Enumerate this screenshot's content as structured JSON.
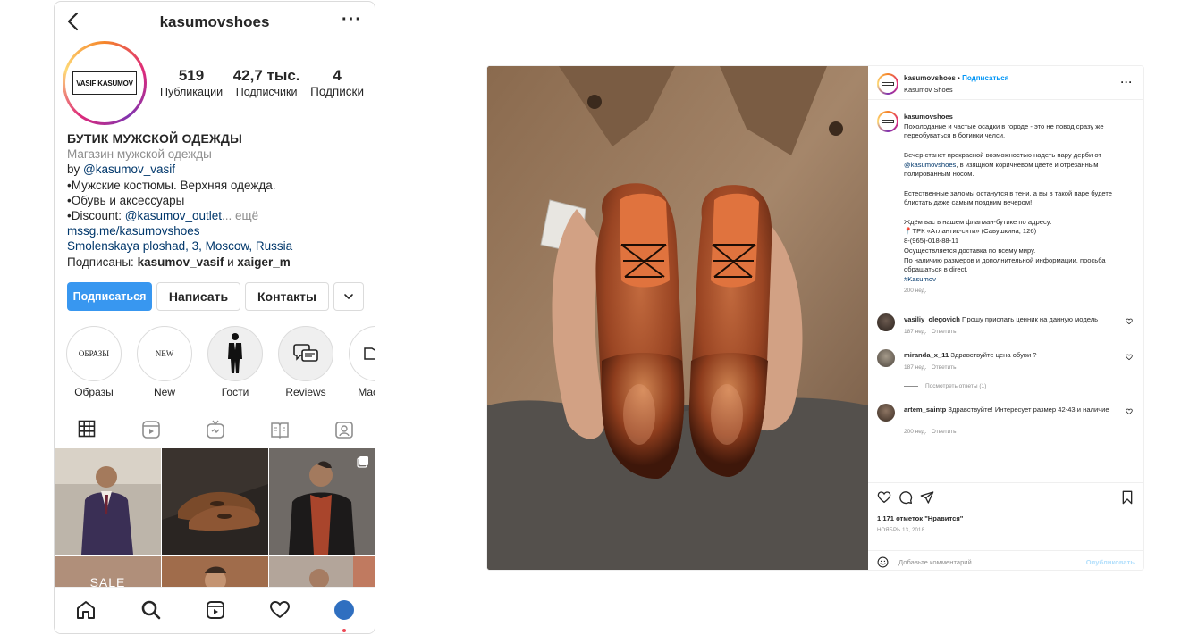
{
  "profile": {
    "username": "kasumovshoes",
    "logo_text": "VASIF KASUMOV",
    "stats": [
      {
        "value": "519",
        "label": "Публикации"
      },
      {
        "value": "42,7 тыс.",
        "label": "Подписчики"
      },
      {
        "value": "4",
        "label": "Подписки"
      }
    ],
    "bio": {
      "name": "БУТИК МУЖСКОЙ ОДЕЖДЫ",
      "category": "Магазин мужской одежды",
      "by_prefix": "by ",
      "by_handle": "@kasumov_vasif",
      "line1": "•Мужские костюмы. Верхняя одежда.",
      "line2": "•Обувь и аксессуары",
      "line3_prefix": "•Discount: ",
      "line3_handle": "@kasumov_outlet",
      "more": "... ещё",
      "link": "mssg.me/kasumovshoes",
      "address": "Smolenskaya ploshad, 3, Moscow, Russia",
      "followed_prefix": "Подписаны: ",
      "followed_user1": "kasumov_vasif",
      "followed_and": " и ",
      "followed_user2": "xaiger_m"
    },
    "buttons": {
      "follow": "Подписаться",
      "message": "Написать",
      "contacts": "Контакты"
    },
    "highlights": [
      {
        "label": "Образы",
        "cover": "ОБРАЗЫ"
      },
      {
        "label": "New",
        "cover": "NEW"
      },
      {
        "label": "Гости",
        "cover": ""
      },
      {
        "label": "Reviews",
        "cover": ""
      },
      {
        "label": "Мастер",
        "cover": ""
      }
    ],
    "grid_sale_text": "SALE"
  },
  "post": {
    "username": "kasumovshoes",
    "follow": "Подписаться",
    "separator": "•",
    "location": "Kasumov Shoes",
    "caption": {
      "user": "kasumovshoes",
      "p1": "Похолодание и частые осадки в городе - это не повод сразу же переобуваться в ботинки челси.",
      "p2_before": "Вечер станет прекрасной возможностью надеть пару дерби от ",
      "p2_link": "@kasumovshoes",
      "p2_after": ", в изящном коричневом цвете и отрезанным полированным носом.",
      "p3": "Естественные заломы останутся в тени, а вы в такой паре будете блистать даже самым поздним вечером!",
      "p4_l1": "Ждём вас в нашем флагман-бутике по адресу:",
      "p4_l2": "📍ТРК «Атлантик-сити» (Савушкина, 126)",
      "p4_l3": "8-(965)-018-88-11",
      "p4_l4": "Осуществляется доставка по всему миру.",
      "p4_l5": "По наличию размеров и дополнительной информации, просьба обращаться в direct.",
      "hashtag": "#Kasumov",
      "time": "200 нед."
    },
    "comments": [
      {
        "user": "vasiliy_olegovich",
        "text": "Прошу прислать ценник на данную модель",
        "time": "187 нед.",
        "reply": "Ответить"
      },
      {
        "user": "miranda_x_11",
        "text": "Здравствуйте цена обуви ?",
        "time": "187 нед.",
        "reply": "Ответить"
      },
      {
        "user": "artem_saintp",
        "text": "Здравствуйте! Интересует размер 42-43 и наличие",
        "time": "200 нед.",
        "reply": "Ответить"
      }
    ],
    "view_replies": "Посмотреть ответы (1)",
    "likes": "1 171 отметок \"Нравится\"",
    "date": "НОЯБРЬ 13, 2018",
    "comment_placeholder": "Добавьте комментарий...",
    "publish": "Опубликовать"
  }
}
